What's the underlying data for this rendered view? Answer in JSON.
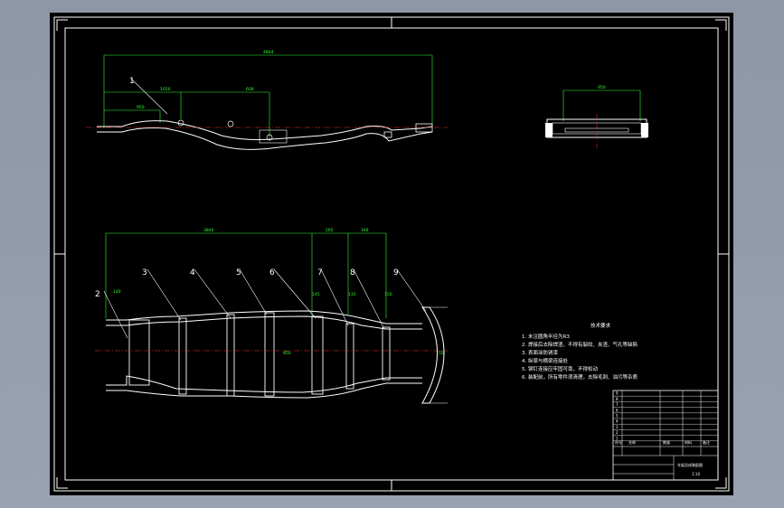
{
  "drawing": {
    "part_numbers": [
      "1",
      "2",
      "3",
      "4",
      "5",
      "6",
      "7",
      "8",
      "9"
    ],
    "dimensions": {
      "side_total": "4804",
      "side_a": "1050",
      "side_b": "608",
      "side_c": "950",
      "end_width": "950",
      "plan_total": "3840",
      "plan_a": "265",
      "plan_b": "348",
      "plan_c": "140",
      "plan_d": "145",
      "plan_e": "135",
      "plan_f": "150",
      "plan_g": "55",
      "plan_mid": "850"
    },
    "tech_title": "技术要求",
    "tech_notes": [
      "1. 未注圆角半径为R3",
      "2. 焊接后去除焊渣，不得有裂纹、夹渣、气孔等缺陷",
      "3. 表面涂防锈漆",
      "4. 纵梁与横梁连接处",
      "5. 铆钉连接应牢固可靠，不得松动",
      "6. 装配前，所有零件须清理，去除毛刺、油污等杂质"
    ],
    "title_block": {
      "rows": [
        "9",
        "8",
        "7",
        "6",
        "5",
        "4",
        "3",
        "2",
        "1"
      ],
      "headers": [
        "序号",
        "名称",
        "数量",
        "材料",
        "备注"
      ],
      "title": "车架总成装配图",
      "scale": "1:10"
    }
  },
  "colors": {
    "background": "#000000",
    "lines": "#ffffff",
    "dimensions": "#30ff30",
    "centerline": "#ff3030"
  }
}
